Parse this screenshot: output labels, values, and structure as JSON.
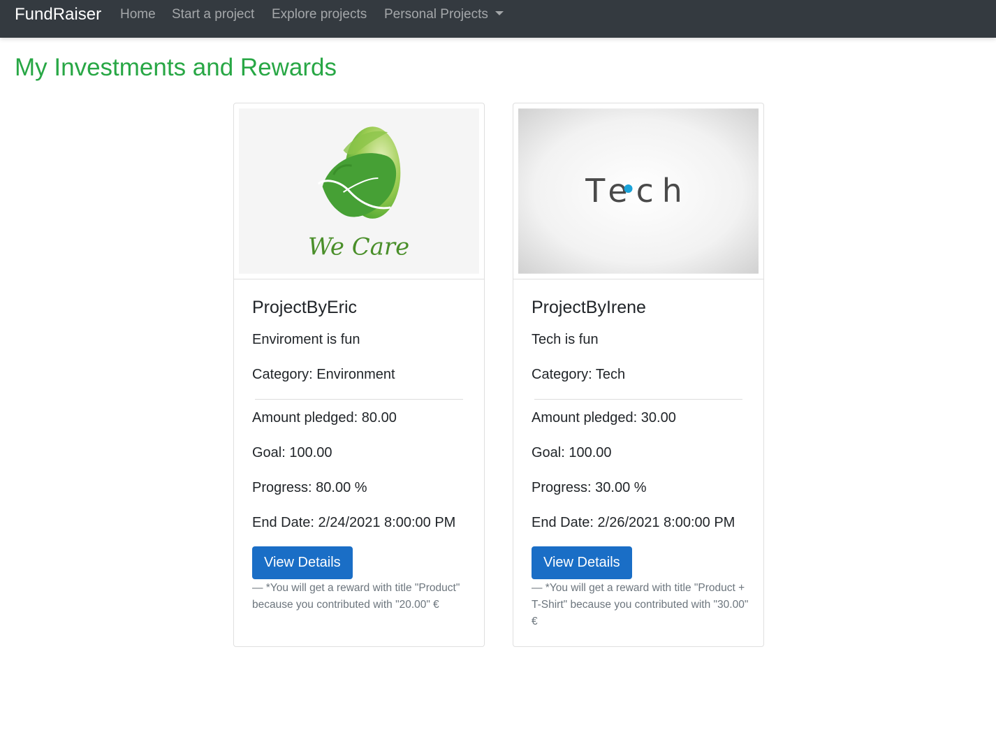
{
  "navbar": {
    "brand": "FundRaiser",
    "links": [
      "Home",
      "Start a project",
      "Explore projects",
      "Personal Projects"
    ]
  },
  "page": {
    "title": "My Investments and Rewards"
  },
  "projects": [
    {
      "title": "ProjectByEric",
      "description": "Enviroment is fun",
      "category_label": "Category:",
      "category": "Environment",
      "amount_label": "Amount pledged:",
      "amount": "80.00",
      "goal_label": "Goal:",
      "goal": "100.00",
      "progress_label": "Progress:",
      "progress": "80.00 %",
      "end_label": "End Date:",
      "end_date": "2/24/2021 8:00:00 PM",
      "button": "View Details",
      "reward": "— *You will get a reward with title \"Product\" because you contributed with \"20.00\" €",
      "image_text": "We Care",
      "image_icon": "globe-leaf-icon"
    },
    {
      "title": "ProjectByIrene",
      "description": "Tech is fun",
      "category_label": "Category:",
      "category": "Tech",
      "amount_label": "Amount pledged:",
      "amount": "30.00",
      "goal_label": "Goal:",
      "goal": "100.00",
      "progress_label": "Progress:",
      "progress": "30.00 %",
      "end_label": "End Date:",
      "end_date": "2/26/2021 8:00:00 PM",
      "button": "View Details",
      "reward": "— *You will get a reward with title \"Product + T-Shirt\" because you contributed with \"30.00\" €",
      "image_text": "Tech",
      "image_icon": "tech-logo"
    }
  ],
  "colors": {
    "navbar_bg": "#343a40",
    "title_green": "#28a745",
    "button_blue": "#1a6ec6",
    "muted": "#6c757d"
  }
}
